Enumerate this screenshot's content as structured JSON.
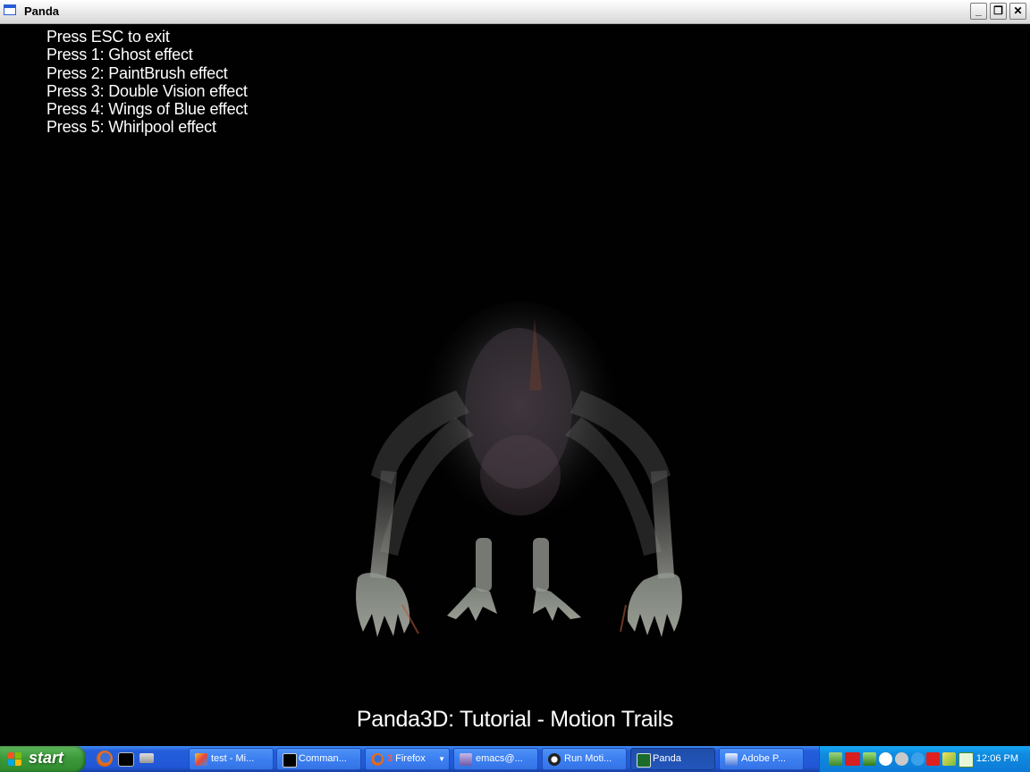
{
  "window": {
    "title": "Panda",
    "buttons": {
      "minimize": "_",
      "maximize": "❐",
      "close": "✕"
    }
  },
  "instructions": [
    "Press ESC to exit",
    "Press 1: Ghost effect",
    "Press 2: PaintBrush effect",
    "Press 3: Double Vision effect",
    "Press 4: Wings of Blue effect",
    "Press 5: Whirlpool effect"
  ],
  "tutorial_title": "Panda3D: Tutorial - Motion Trails",
  "taskbar": {
    "start_label": "start",
    "quick_launch": [
      "firefox-icon",
      "command-prompt-icon",
      "show-desktop-icon"
    ],
    "tasks": [
      {
        "label": "test - Mi...",
        "icon": "paint-icon"
      },
      {
        "label": "Comman...",
        "icon": "command-prompt-icon"
      },
      {
        "label": "Firefox",
        "badge": "3",
        "icon": "firefox-icon"
      },
      {
        "label": "emacs@...",
        "icon": "emacs-icon"
      },
      {
        "label": "Run Moti...",
        "icon": "panda-icon"
      },
      {
        "label": "Panda",
        "icon": "panda-window-icon",
        "active": true
      },
      {
        "label": "Adobe P...",
        "icon": "adobe-icon"
      }
    ],
    "tray_icons": [
      "network-icon",
      "ati-icon",
      "antivirus-icon",
      "google-icon",
      "volume-icon",
      "update-icon",
      "flash-icon",
      "pen-icon",
      "vc-icon"
    ],
    "clock": "12:06 PM"
  },
  "colors": {
    "taskbar": "#245edb",
    "start": "#3c9a3a",
    "tray": "#0f8ce0",
    "viewport": "#010101"
  }
}
